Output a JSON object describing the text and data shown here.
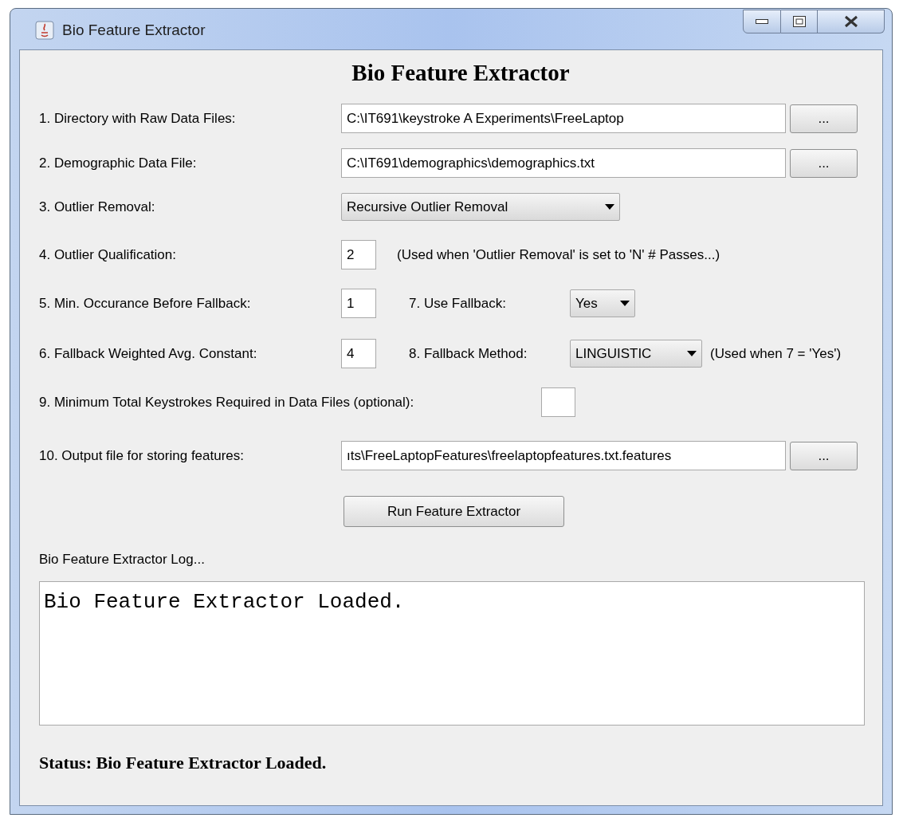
{
  "window": {
    "title": "Bio Feature Extractor"
  },
  "heading": "Bio Feature Extractor",
  "raw_data_dir": {
    "label": "1. Directory with Raw Data Files:",
    "value": "C:\\IT691\\keystroke A Experiments\\FreeLaptop",
    "browse": "..."
  },
  "demographic_file": {
    "label": "2. Demographic Data File:",
    "value": "C:\\IT691\\demographics\\demographics.txt",
    "browse": "..."
  },
  "outlier_removal": {
    "label": "3. Outlier Removal:",
    "value": "Recursive Outlier Removal"
  },
  "outlier_qualification": {
    "label": "4. Outlier Qualification:",
    "value": "2",
    "note": "(Used when 'Outlier Removal' is set to 'N' # Passes...)"
  },
  "min_occurance": {
    "label": "5. Min. Occurance Before Fallback:",
    "value": "1"
  },
  "use_fallback": {
    "label": "7. Use Fallback:",
    "value": "Yes"
  },
  "weighted_avg": {
    "label": "6. Fallback Weighted Avg. Constant:",
    "value": "4"
  },
  "fallback_method": {
    "label": "8. Fallback Method:",
    "value": "LINGUISTIC",
    "note": "(Used when 7 = 'Yes')"
  },
  "min_keystrokes": {
    "label": "9. Minimum Total Keystrokes Required in Data Files (optional):"
  },
  "output_file": {
    "label": "10. Output file for storing features:",
    "value": "ıts\\FreeLaptopFeatures\\freelaptopfeatures.txt.features",
    "browse": "..."
  },
  "run_button": "Run Feature Extractor",
  "log": {
    "label": "Bio Feature Extractor Log...",
    "text": "Bio Feature Extractor Loaded."
  },
  "status": "Status: Bio Feature Extractor Loaded."
}
